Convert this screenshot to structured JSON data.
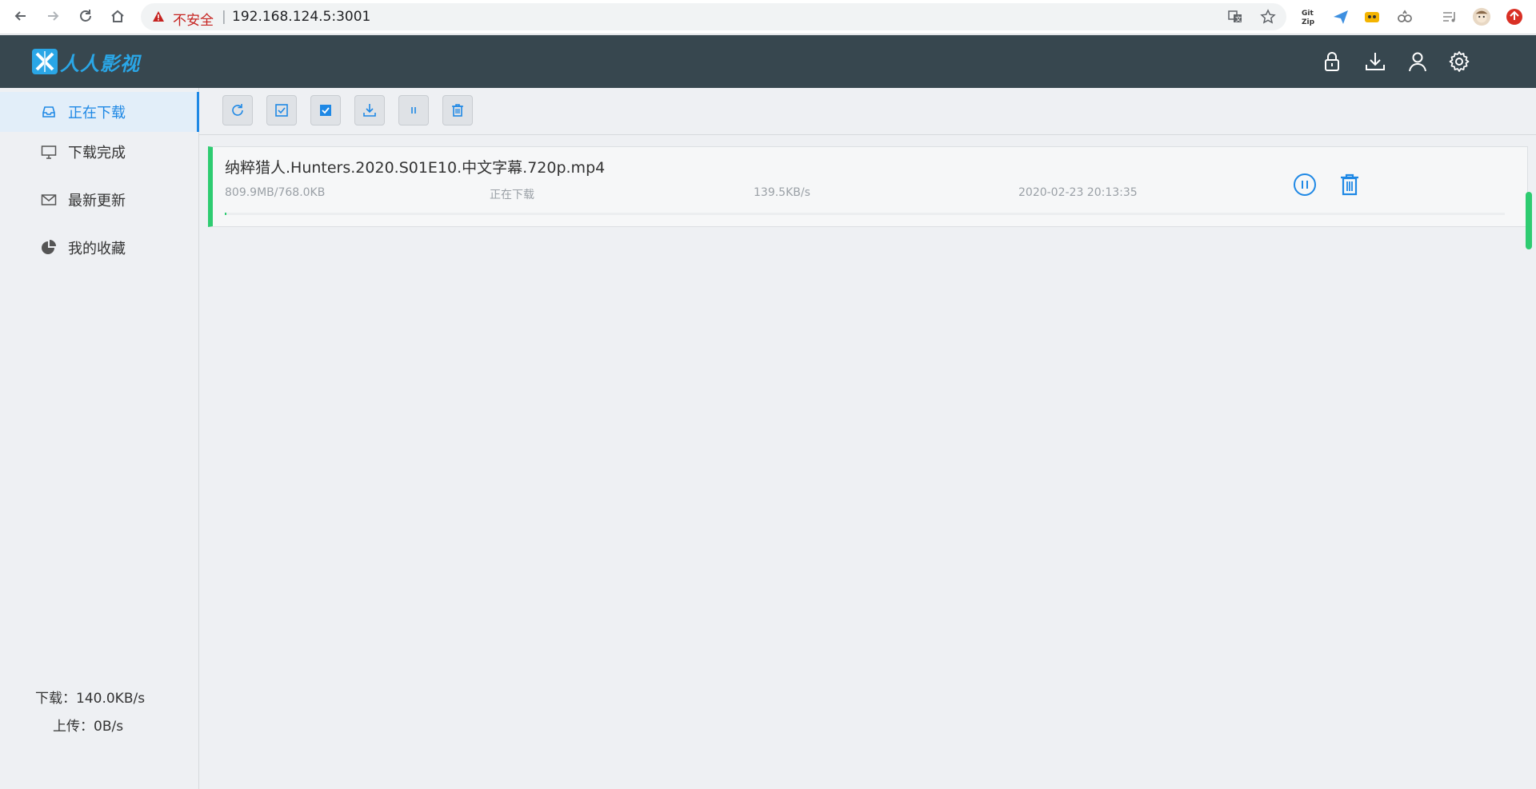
{
  "browser": {
    "security_label": "不安全",
    "separator": "|",
    "url": "192.168.124.5:3001"
  },
  "app": {
    "logo_text": "人人影视",
    "brand_color": "#2aa6e6",
    "header_icons": [
      "lock-icon",
      "download-icon",
      "user-icon",
      "settings-icon"
    ]
  },
  "sidebar": {
    "items": [
      {
        "label": "正在下载",
        "icon": "inbox-icon",
        "active": true
      },
      {
        "label": "下载完成",
        "icon": "monitor-icon",
        "active": false
      },
      {
        "label": "最新更新",
        "icon": "mail-icon",
        "active": false
      },
      {
        "label": "我的收藏",
        "icon": "pie-chart-icon",
        "active": false
      }
    ],
    "download_speed": "下载：140.0KB/s",
    "upload_speed": "上传：0B/s"
  },
  "toolbar": {
    "buttons": [
      "refresh-icon",
      "checkbox-icon",
      "checkbox-checked-icon",
      "download-icon",
      "pause-icon",
      "trash-icon"
    ]
  },
  "tasks": [
    {
      "title": "纳粹猎人.Hunters.2020.S01E10.中文字幕.720p.mp4",
      "size": "809.9MB/768.0KB",
      "status": "正在下载",
      "speed": "139.5KB/s",
      "time": "2020-02-23 20:13:35",
      "progress": 0.001,
      "status_color": "#2ecc71"
    }
  ],
  "colors": {
    "header_bg": "#37474f",
    "accent": "#1e88e5",
    "success": "#2ecc71"
  }
}
